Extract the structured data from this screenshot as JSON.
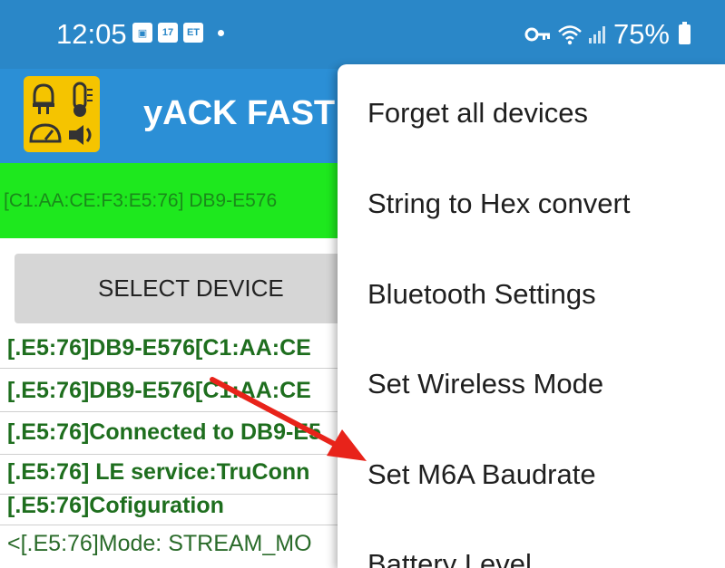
{
  "status_bar": {
    "time": "12:05",
    "notif_icons": [
      {
        "name": "image-icon",
        "glyph": "▣"
      },
      {
        "name": "calendar-icon",
        "glyph": "17"
      },
      {
        "name": "et-icon",
        "glyph": "ET"
      }
    ],
    "battery_percent": "75%"
  },
  "app_bar": {
    "title": "yACK FAST"
  },
  "device_strip": {
    "text": "[C1:AA:CE:F3:E5:76] DB9-E576"
  },
  "select_device_button": "SELECT DEVICE",
  "log": [
    {
      "text": "[.E5:76]DB9-E576[C1:AA:CE",
      "bold": true
    },
    {
      "text": "[.E5:76]DB9-E576[C1:AA:CE",
      "bold": true
    },
    {
      "text": "[.E5:76]Connected to DB9-E5",
      "bold": true
    },
    {
      "text": "[.E5:76]  LE service:TruConn",
      "bold": true
    },
    {
      "text": "[.E5:76]Cofiguration",
      "bold": true
    },
    {
      "text": "<[.E5:76]Mode: STREAM_MO",
      "bold": false
    }
  ],
  "menu": {
    "items": [
      "Forget all devices",
      "String to Hex convert",
      "Bluetooth Settings",
      "Set Wireless Mode",
      "Set M6A Baudrate",
      "Battery Level"
    ]
  },
  "colors": {
    "status_bar": "#2a87c8",
    "app_bar": "#2b8fd6",
    "device_strip": "#1ee81e",
    "arrow": "#e8231a"
  }
}
